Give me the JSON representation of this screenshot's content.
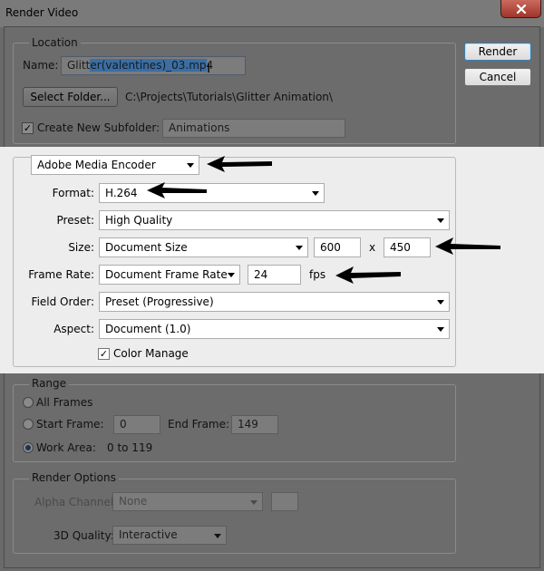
{
  "window": {
    "title": "Render Video"
  },
  "buttons": {
    "render": "Render",
    "cancel": "Cancel",
    "select_folder": "Select Folder..."
  },
  "location": {
    "legend": "Location",
    "name_label": "Name:",
    "name_value_prefix": "Glitt",
    "name_value_selected": "er(valentines)_03.mp",
    "name_value_suffix": "4",
    "folder_path": "C:\\Projects\\Tutorials\\Glitter Animation\\",
    "subfolder_label": "Create New Subfolder:",
    "subfolder_checked": true,
    "subfolder_value": "Animations"
  },
  "encoder": {
    "selected": "Adobe Media Encoder",
    "format_label": "Format:",
    "format_value": "H.264",
    "preset_label": "Preset:",
    "preset_value": "High Quality",
    "size_label": "Size:",
    "size_value": "Document Size",
    "width": "600",
    "x_sep": "x",
    "height": "450",
    "framerate_label": "Frame Rate:",
    "framerate_value": "Document Frame Rate",
    "fps_value": "24",
    "fps_unit": "fps",
    "fieldorder_label": "Field Order:",
    "fieldorder_value": "Preset (Progressive)",
    "aspect_label": "Aspect:",
    "aspect_value": "Document (1.0)",
    "color_manage_label": "Color Manage",
    "color_manage_checked": true
  },
  "range": {
    "legend": "Range",
    "all_frames": "All Frames",
    "start_frame_label": "Start Frame:",
    "start_frame": "0",
    "end_frame_label": "End Frame:",
    "end_frame": "149",
    "work_area_label": "Work Area:",
    "work_area_value": "0 to 119",
    "selected": "Work Area"
  },
  "render_options": {
    "legend": "Render Options",
    "alpha_label": "Alpha Channel:",
    "alpha_value": "None",
    "quality_label": "3D Quality:",
    "quality_value": "Interactive"
  },
  "colors": {
    "highlight_bg": "#ededed",
    "dim_bg": "#6c6c6c",
    "selection": "#3a6ea5"
  }
}
